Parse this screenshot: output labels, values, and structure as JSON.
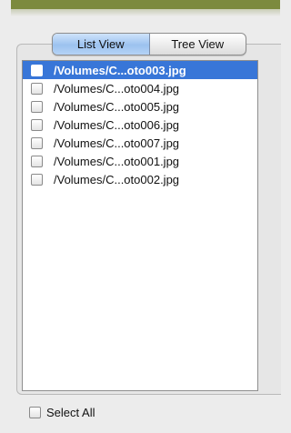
{
  "view_toggle": {
    "list_view_label": "List View",
    "tree_view_label": "Tree View",
    "selected": "List View"
  },
  "files": [
    {
      "name": "/Volumes/C...oto003.jpg",
      "checked": false,
      "selected": true
    },
    {
      "name": "/Volumes/C...oto004.jpg",
      "checked": false,
      "selected": false
    },
    {
      "name": "/Volumes/C...oto005.jpg",
      "checked": false,
      "selected": false
    },
    {
      "name": "/Volumes/C...oto006.jpg",
      "checked": false,
      "selected": false
    },
    {
      "name": "/Volumes/C...oto007.jpg",
      "checked": false,
      "selected": false
    },
    {
      "name": "/Volumes/C...oto001.jpg",
      "checked": false,
      "selected": false
    },
    {
      "name": "/Volumes/C...oto002.jpg",
      "checked": false,
      "selected": false
    }
  ],
  "select_all": {
    "label": "Select All",
    "checked": false
  },
  "colors": {
    "selection": "#3876d8",
    "top_bar": "#7c8a3e"
  }
}
